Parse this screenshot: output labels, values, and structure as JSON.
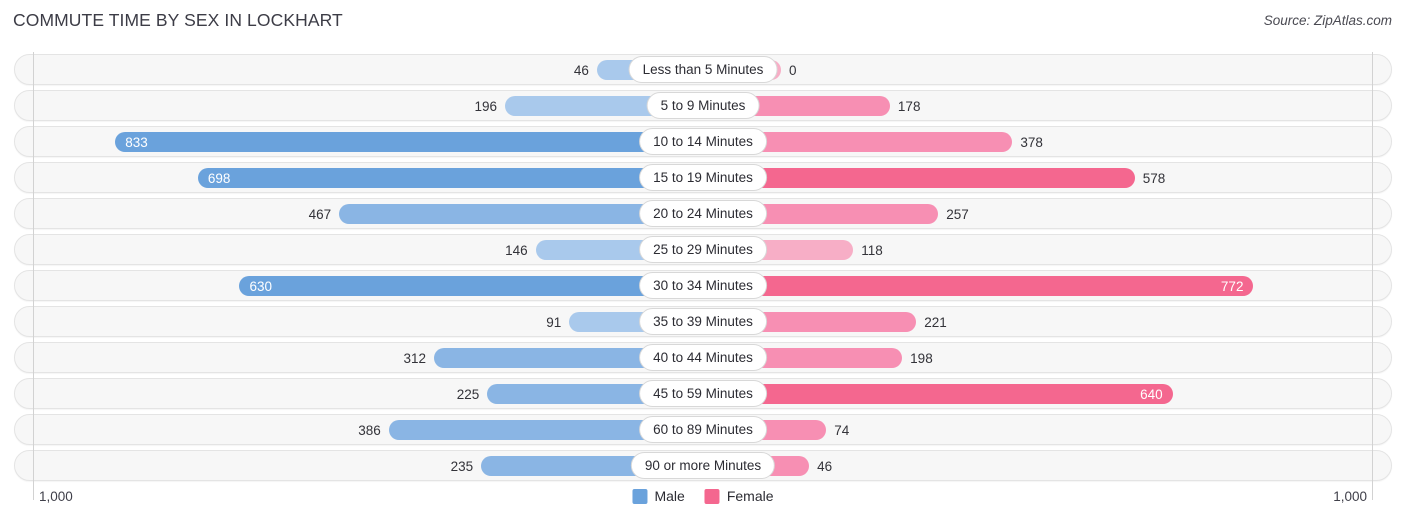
{
  "header": {
    "title": "COMMUTE TIME BY SEX IN LOCKHART",
    "source": "Source: ZipAtlas.com"
  },
  "axis": {
    "left_label": "1,000",
    "right_label": "1,000"
  },
  "legend": {
    "items": [
      {
        "label": "Male",
        "color": "#6aa2dc"
      },
      {
        "label": "Female",
        "color": "#f4678f"
      }
    ]
  },
  "colors": {
    "male_strong": "#6aa2dc",
    "male_light": "#a9c9ec",
    "female_strong": "#f4678f",
    "female_light": "#f7aec6",
    "track_bg": "#f7f7f7",
    "track_border": "#e4e4e4"
  },
  "chart_data": {
    "type": "bar",
    "title": "COMMUTE TIME BY SEX IN LOCKHART",
    "subtitle": "",
    "orientation": "horizontal-diverging",
    "xlabel": "",
    "ylabel": "",
    "xlim": [
      -1000,
      1000
    ],
    "grid": false,
    "legend_position": "bottom-center",
    "categories": [
      "Less than 5 Minutes",
      "5 to 9 Minutes",
      "10 to 14 Minutes",
      "15 to 19 Minutes",
      "20 to 24 Minutes",
      "25 to 29 Minutes",
      "30 to 34 Minutes",
      "35 to 39 Minutes",
      "40 to 44 Minutes",
      "45 to 59 Minutes",
      "60 to 89 Minutes",
      "90 or more Minutes"
    ],
    "series": [
      {
        "name": "Male",
        "side": "left",
        "values": [
          46,
          196,
          833,
          698,
          467,
          146,
          630,
          91,
          312,
          225,
          386,
          235
        ]
      },
      {
        "name": "Female",
        "side": "right",
        "values": [
          0,
          178,
          378,
          578,
          257,
          118,
          772,
          221,
          198,
          640,
          74,
          46
        ]
      }
    ]
  },
  "rows": [
    {
      "label": "Less than 5 Minutes",
      "male": "46",
      "female": "0",
      "male_shade": "light",
      "female_shade": "light",
      "male_inside": false,
      "female_inside": false
    },
    {
      "label": "5 to 9 Minutes",
      "male": "196",
      "female": "178",
      "male_shade": "light",
      "female_shade": "mid",
      "male_inside": false,
      "female_inside": false
    },
    {
      "label": "10 to 14 Minutes",
      "male": "833",
      "female": "378",
      "male_shade": "strong",
      "female_shade": "mid",
      "male_inside": true,
      "female_inside": false
    },
    {
      "label": "15 to 19 Minutes",
      "male": "698",
      "female": "578",
      "male_shade": "strong",
      "female_shade": "strong",
      "male_inside": true,
      "female_inside": false
    },
    {
      "label": "20 to 24 Minutes",
      "male": "467",
      "female": "257",
      "male_shade": "mid",
      "female_shade": "mid",
      "male_inside": false,
      "female_inside": false
    },
    {
      "label": "25 to 29 Minutes",
      "male": "146",
      "female": "118",
      "male_shade": "light",
      "female_shade": "light",
      "male_inside": false,
      "female_inside": false
    },
    {
      "label": "30 to 34 Minutes",
      "male": "630",
      "female": "772",
      "male_shade": "strong",
      "female_shade": "strong",
      "male_inside": true,
      "female_inside": true
    },
    {
      "label": "35 to 39 Minutes",
      "male": "91",
      "female": "221",
      "male_shade": "light",
      "female_shade": "mid",
      "male_inside": false,
      "female_inside": false
    },
    {
      "label": "40 to 44 Minutes",
      "male": "312",
      "female": "198",
      "male_shade": "mid",
      "female_shade": "mid",
      "male_inside": false,
      "female_inside": false
    },
    {
      "label": "45 to 59 Minutes",
      "male": "225",
      "female": "640",
      "male_shade": "mid",
      "female_shade": "strong",
      "male_inside": false,
      "female_inside": true
    },
    {
      "label": "60 to 89 Minutes",
      "male": "386",
      "female": "74",
      "male_shade": "mid",
      "female_shade": "mid",
      "male_inside": false,
      "female_inside": false
    },
    {
      "label": "90 or more Minutes",
      "male": "235",
      "female": "46",
      "male_shade": "mid",
      "female_shade": "mid",
      "male_inside": false,
      "female_inside": false
    }
  ]
}
